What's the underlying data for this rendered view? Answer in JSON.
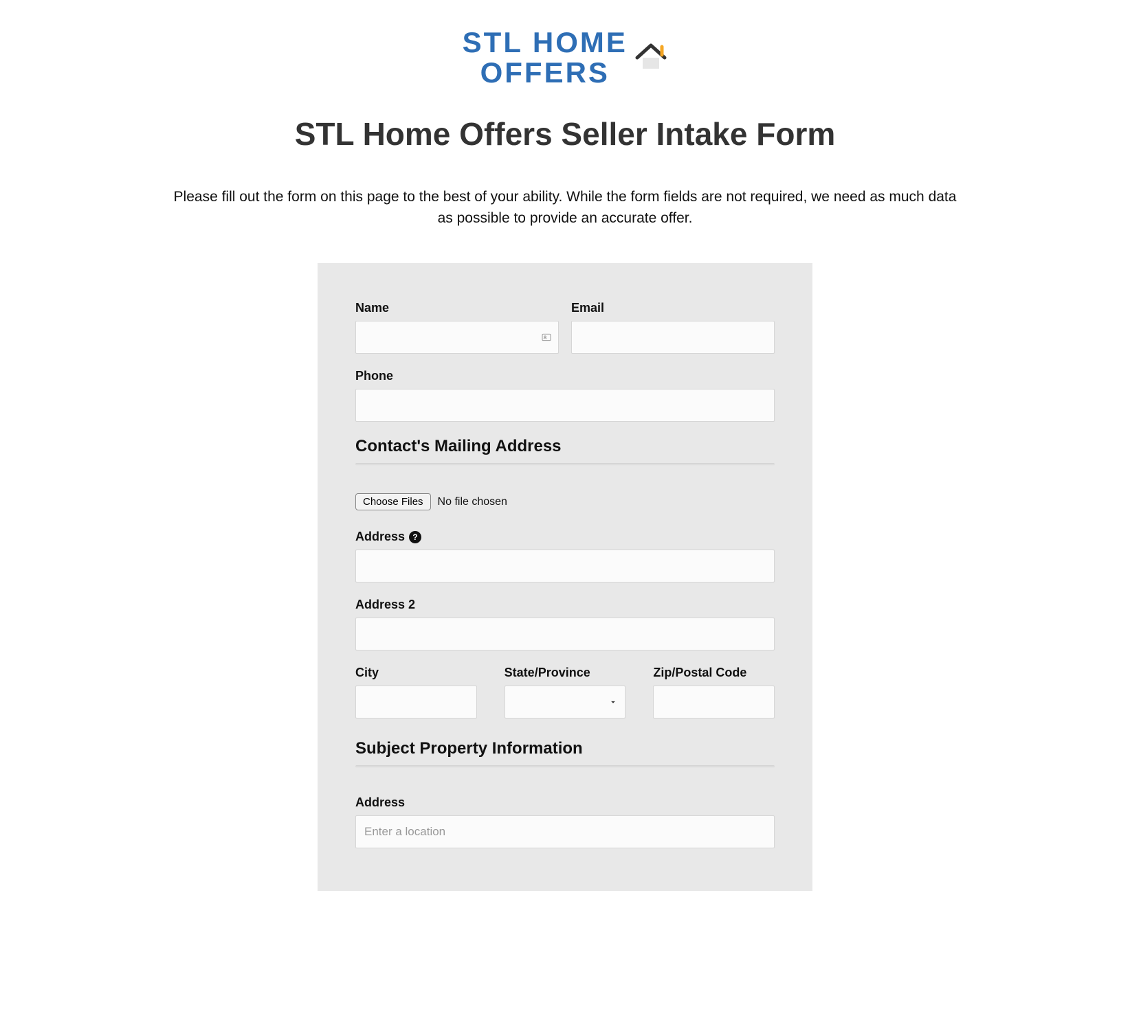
{
  "logo": {
    "line1": "STL HOME",
    "line2": "OFFERS"
  },
  "header": {
    "title": "STL Home Offers Seller Intake Form",
    "description": "Please fill out the form on this page to the best of your ability. While the form fields are not required, we need as much data as possible to provide an accurate offer."
  },
  "form": {
    "name": {
      "label": "Name",
      "value": ""
    },
    "email": {
      "label": "Email",
      "value": ""
    },
    "phone": {
      "label": "Phone",
      "value": ""
    },
    "section_contact_address": "Contact's Mailing Address",
    "file": {
      "button": "Choose Files",
      "status": "No file chosen"
    },
    "address": {
      "label": "Address",
      "value": ""
    },
    "address2": {
      "label": "Address 2",
      "value": ""
    },
    "city": {
      "label": "City",
      "value": ""
    },
    "state": {
      "label": "State/Province",
      "value": ""
    },
    "zip": {
      "label": "Zip/Postal Code",
      "value": ""
    },
    "section_subject_property": "Subject Property Information",
    "subject_address": {
      "label": "Address",
      "placeholder": "Enter a location",
      "value": ""
    }
  }
}
